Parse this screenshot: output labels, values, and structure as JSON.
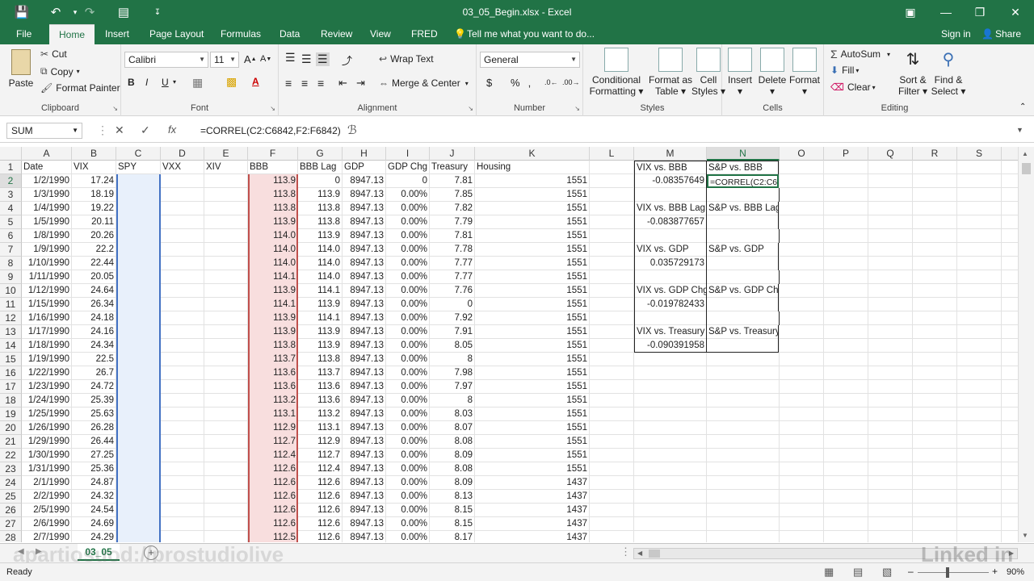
{
  "window": {
    "title": "03_05_Begin.xlsx - Excel"
  },
  "tabs": {
    "items": [
      "File",
      "Home",
      "Insert",
      "Page Layout",
      "Formulas",
      "Data",
      "Review",
      "View",
      "FRED"
    ],
    "tell_me": "Tell me what you want to do...",
    "sign_in": "Sign in",
    "share": "Share"
  },
  "ribbon": {
    "clipboard": {
      "paste": "Paste",
      "cut": "Cut",
      "copy": "Copy",
      "format_painter": "Format Painter",
      "label": "Clipboard"
    },
    "font": {
      "name": "Calibri",
      "size": "11",
      "label": "Font"
    },
    "alignment": {
      "wrap_text": "Wrap Text",
      "merge_center": "Merge & Center",
      "label": "Alignment"
    },
    "number": {
      "format": "General",
      "label": "Number"
    },
    "styles": {
      "conditional": [
        "Conditional",
        "Formatting"
      ],
      "format_table": [
        "Format as",
        "Table"
      ],
      "cell_styles": [
        "Cell",
        "Styles"
      ],
      "label": "Styles"
    },
    "cells": {
      "insert": "Insert",
      "delete": "Delete",
      "format": "Format",
      "label": "Cells"
    },
    "editing": {
      "autosum": "AutoSum",
      "fill": "Fill",
      "clear": "Clear",
      "sort_filter": [
        "Sort &",
        "Filter"
      ],
      "find_select": [
        "Find &",
        "Select"
      ],
      "label": "Editing"
    }
  },
  "formula_bar": {
    "name_box": "SUM",
    "formula": "=CORREL(C2:C6842,F2:F6842)"
  },
  "grid": {
    "columns": [
      "A",
      "B",
      "C",
      "D",
      "E",
      "F",
      "G",
      "H",
      "I",
      "J",
      "K",
      "L",
      "M",
      "N",
      "O",
      "P",
      "Q",
      "R",
      "S"
    ],
    "rows": [
      1,
      2,
      3,
      4,
      5,
      6,
      7,
      8,
      9,
      10,
      11,
      12,
      13,
      14,
      15,
      16,
      17,
      18,
      19,
      20,
      21,
      22,
      23,
      24,
      25,
      26,
      27,
      28
    ],
    "headers": [
      "Date",
      "VIX",
      "SPY",
      "VXX",
      "XIV",
      "BBB",
      "BBB Lag",
      "GDP",
      "GDP Chg",
      "Treasury",
      "Housing"
    ],
    "data": [
      [
        "1/2/1990",
        "17.24",
        "113.9",
        "0",
        "8947.13",
        "0",
        "7.81",
        "1551"
      ],
      [
        "1/3/1990",
        "18.19",
        "113.8",
        "113.9",
        "8947.13",
        "0.00%",
        "7.85",
        "1551"
      ],
      [
        "1/4/1990",
        "19.22",
        "113.8",
        "113.8",
        "8947.13",
        "0.00%",
        "7.82",
        "1551"
      ],
      [
        "1/5/1990",
        "20.11",
        "113.9",
        "113.8",
        "8947.13",
        "0.00%",
        "7.79",
        "1551"
      ],
      [
        "1/8/1990",
        "20.26",
        "114.0",
        "113.9",
        "8947.13",
        "0.00%",
        "7.81",
        "1551"
      ],
      [
        "1/9/1990",
        "22.2",
        "114.0",
        "114.0",
        "8947.13",
        "0.00%",
        "7.78",
        "1551"
      ],
      [
        "1/10/1990",
        "22.44",
        "114.0",
        "114.0",
        "8947.13",
        "0.00%",
        "7.77",
        "1551"
      ],
      [
        "1/11/1990",
        "20.05",
        "114.1",
        "114.0",
        "8947.13",
        "0.00%",
        "7.77",
        "1551"
      ],
      [
        "1/12/1990",
        "24.64",
        "113.9",
        "114.1",
        "8947.13",
        "0.00%",
        "7.76",
        "1551"
      ],
      [
        "1/15/1990",
        "26.34",
        "114.1",
        "113.9",
        "8947.13",
        "0.00%",
        "0",
        "1551"
      ],
      [
        "1/16/1990",
        "24.18",
        "113.9",
        "114.1",
        "8947.13",
        "0.00%",
        "7.92",
        "1551"
      ],
      [
        "1/17/1990",
        "24.16",
        "113.9",
        "113.9",
        "8947.13",
        "0.00%",
        "7.91",
        "1551"
      ],
      [
        "1/18/1990",
        "24.34",
        "113.8",
        "113.9",
        "8947.13",
        "0.00%",
        "8.05",
        "1551"
      ],
      [
        "1/19/1990",
        "22.5",
        "113.7",
        "113.8",
        "8947.13",
        "0.00%",
        "8",
        "1551"
      ],
      [
        "1/22/1990",
        "26.7",
        "113.6",
        "113.7",
        "8947.13",
        "0.00%",
        "7.98",
        "1551"
      ],
      [
        "1/23/1990",
        "24.72",
        "113.6",
        "113.6",
        "8947.13",
        "0.00%",
        "7.97",
        "1551"
      ],
      [
        "1/24/1990",
        "25.39",
        "113.2",
        "113.6",
        "8947.13",
        "0.00%",
        "8",
        "1551"
      ],
      [
        "1/25/1990",
        "25.63",
        "113.1",
        "113.2",
        "8947.13",
        "0.00%",
        "8.03",
        "1551"
      ],
      [
        "1/26/1990",
        "26.28",
        "112.9",
        "113.1",
        "8947.13",
        "0.00%",
        "8.07",
        "1551"
      ],
      [
        "1/29/1990",
        "26.44",
        "112.7",
        "112.9",
        "8947.13",
        "0.00%",
        "8.08",
        "1551"
      ],
      [
        "1/30/1990",
        "27.25",
        "112.4",
        "112.7",
        "8947.13",
        "0.00%",
        "8.09",
        "1551"
      ],
      [
        "1/31/1990",
        "25.36",
        "112.6",
        "112.4",
        "8947.13",
        "0.00%",
        "8.08",
        "1551"
      ],
      [
        "2/1/1990",
        "24.87",
        "112.6",
        "112.6",
        "8947.13",
        "0.00%",
        "8.09",
        "1437"
      ],
      [
        "2/2/1990",
        "24.32",
        "112.6",
        "112.6",
        "8947.13",
        "0.00%",
        "8.13",
        "1437"
      ],
      [
        "2/5/1990",
        "24.54",
        "112.6",
        "112.6",
        "8947.13",
        "0.00%",
        "8.15",
        "1437"
      ],
      [
        "2/6/1990",
        "24.69",
        "112.6",
        "112.6",
        "8947.13",
        "0.00%",
        "8.15",
        "1437"
      ],
      [
        "2/7/1990",
        "24.29",
        "112.5",
        "112.6",
        "8947.13",
        "0.00%",
        "8.17",
        "1437"
      ]
    ],
    "summary": [
      {
        "m_label": "VIX vs. BBB",
        "m_value": "-0.08357649",
        "n_label": "S&P vs. BBB",
        "n_value": "=CORREL(C2:C684"
      },
      {
        "m_label": "VIX vs. BBB Lag",
        "m_value": "-0.083877657",
        "n_label": "S&P vs. BBB Lag",
        "n_value": ""
      },
      {
        "m_label": "VIX vs. GDP",
        "m_value": "0.035729173",
        "n_label": "S&P vs. GDP",
        "n_value": ""
      },
      {
        "m_label": "VIX vs. GDP Chg",
        "m_value": "-0.019782433",
        "n_label": "S&P vs. GDP Chg",
        "n_value": ""
      },
      {
        "m_label": "VIX vs. Treasury",
        "m_value": "-0.090391958",
        "n_label": "S&P vs. Treasury",
        "n_value": ""
      }
    ]
  },
  "sheet_tabs": {
    "active": "03_05"
  },
  "status": {
    "ready": "Ready",
    "zoom": "90%"
  },
  "watermark": {
    "left": "apartiosuod://prostudiolive",
    "right": "Linked in"
  },
  "colors": {
    "brand": "#217346",
    "copy_range_blue": "#4472c4",
    "ref_range_red": "#c0504d",
    "ref_fill": "#f8dede"
  }
}
